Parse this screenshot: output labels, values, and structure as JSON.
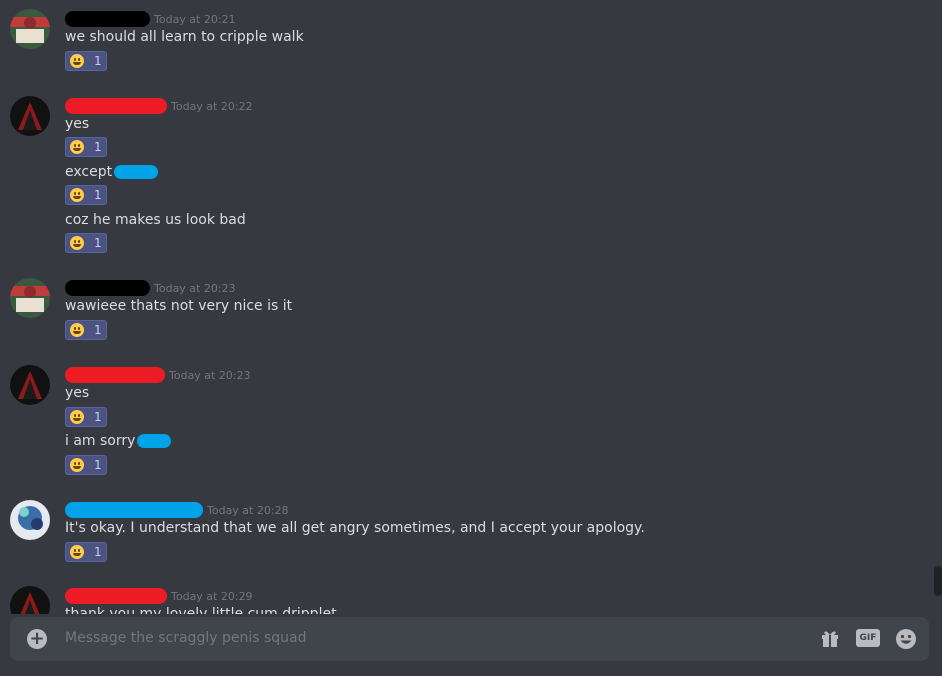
{
  "colors": {
    "background": "#36393f",
    "redact_black": "#000000",
    "redact_red": "#ed1c24",
    "redact_blue": "#00a2e8",
    "reaction_bg": "#4d5380",
    "timestamp": "#72767d"
  },
  "messages": [
    {
      "timestamp": "Today at 20:21",
      "lines": [
        {
          "text": "we should all learn to cripple walk",
          "reaction": {
            "emoji": "zany-face-emoji",
            "count": "1"
          }
        }
      ]
    },
    {
      "timestamp": "Today at 20:22",
      "lines": [
        {
          "text": "yes",
          "reaction": {
            "emoji": "zany-face-emoji",
            "count": "1"
          }
        },
        {
          "text": "except",
          "reaction": {
            "emoji": "zany-face-emoji",
            "count": "1"
          }
        },
        {
          "text": "coz he makes us look bad",
          "reaction": {
            "emoji": "zany-face-emoji",
            "count": "1"
          }
        }
      ]
    },
    {
      "timestamp": "Today at 20:23",
      "lines": [
        {
          "text": "wawieee thats not very nice is it",
          "reaction": {
            "emoji": "zany-face-emoji",
            "count": "1"
          }
        }
      ]
    },
    {
      "timestamp": "Today at 20:23",
      "lines": [
        {
          "text": "yes",
          "reaction": {
            "emoji": "zany-face-emoji",
            "count": "1"
          }
        },
        {
          "text": "i am sorry",
          "reaction": {
            "emoji": "grinning-face-emoji",
            "count": "1"
          }
        }
      ]
    },
    {
      "timestamp": "Today at 20:28",
      "lines": [
        {
          "text": "It's okay. I understand that we all get angry sometimes, and I accept your apology.",
          "reaction": {
            "emoji": "relieved-face-emoji",
            "count": "1"
          }
        }
      ]
    },
    {
      "timestamp": "Today at 20:29",
      "lines": [
        {
          "text": "thank you my lovely little cum dripplet"
        }
      ]
    }
  ],
  "composer": {
    "placeholder": "Message the scraggly penis squad",
    "gif_label": "GIF",
    "icons": [
      "plus-icon",
      "gift-icon",
      "gif-icon",
      "emoji-icon"
    ]
  }
}
